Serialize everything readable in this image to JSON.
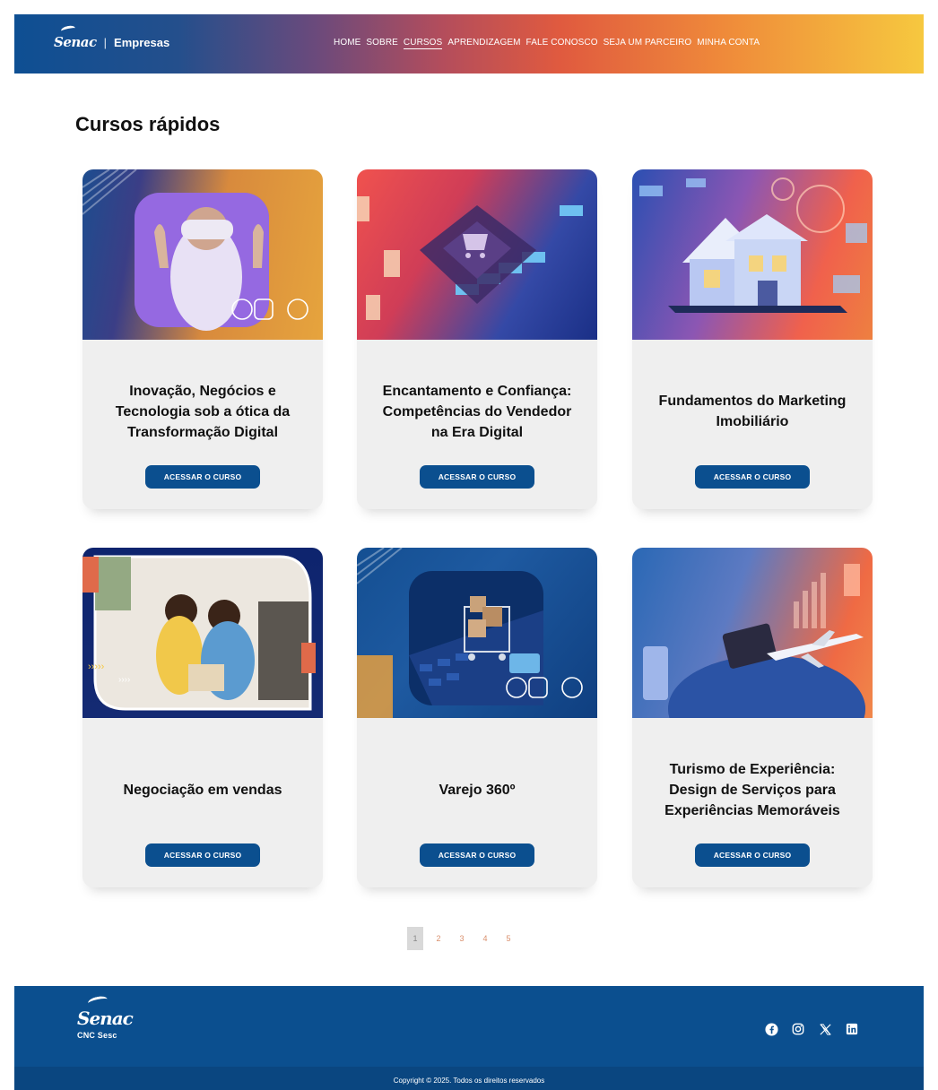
{
  "header": {
    "brand_logo": "Senac",
    "brand_separator": "|",
    "brand_name": "Empresas",
    "nav": [
      {
        "label": "HOME"
      },
      {
        "label": "SOBRE"
      },
      {
        "label": "CURSOS"
      },
      {
        "label": "APRENDIZAGEM"
      },
      {
        "label": "FALE CONOSCO"
      },
      {
        "label": "SEJA UM PARCEIRO"
      },
      {
        "label": "MINHA CONTA"
      }
    ],
    "active_nav": "CURSOS"
  },
  "main": {
    "title": "Cursos rápidos",
    "cards": [
      {
        "title": "Inovação, Negócios e Tecnologia sob a ótica da Transformação Digital",
        "button": "ACESSAR O CURSO",
        "image": "vr-headset-person"
      },
      {
        "title": "Encantamento e Confiança: Competências do Vendedor na Era Digital",
        "button": "ACESSAR O CURSO",
        "image": "shopping-cart-chip"
      },
      {
        "title": "Fundamentos do Marketing Imobiliário",
        "button": "ACESSAR O CURSO",
        "image": "digital-house"
      },
      {
        "title": "Negociação em vendas",
        "button": "ACESSAR O CURSO",
        "image": "shop-attendants"
      },
      {
        "title": "Varejo 360º",
        "button": "ACESSAR O CURSO",
        "image": "cart-on-keyboard"
      },
      {
        "title": "Turismo de Experiência: Design de Serviços para Experiências Memoráveis",
        "button": "ACESSAR O CURSO",
        "image": "airplane-globe"
      }
    ]
  },
  "pagination": {
    "pages": [
      "1",
      "2",
      "3",
      "4",
      "5"
    ],
    "current": "1"
  },
  "footer": {
    "logo": "Senac",
    "logo_sub": "CNC Sesc",
    "socials": [
      "facebook-icon",
      "instagram-icon",
      "x-twitter-icon",
      "linkedin-icon"
    ],
    "copyright": "Copyright © 2025. Todos os direitos reservados"
  },
  "colors": {
    "primary": "#0b4f8f",
    "card_bg": "#efefef",
    "pager_text": "#d98f6c"
  }
}
